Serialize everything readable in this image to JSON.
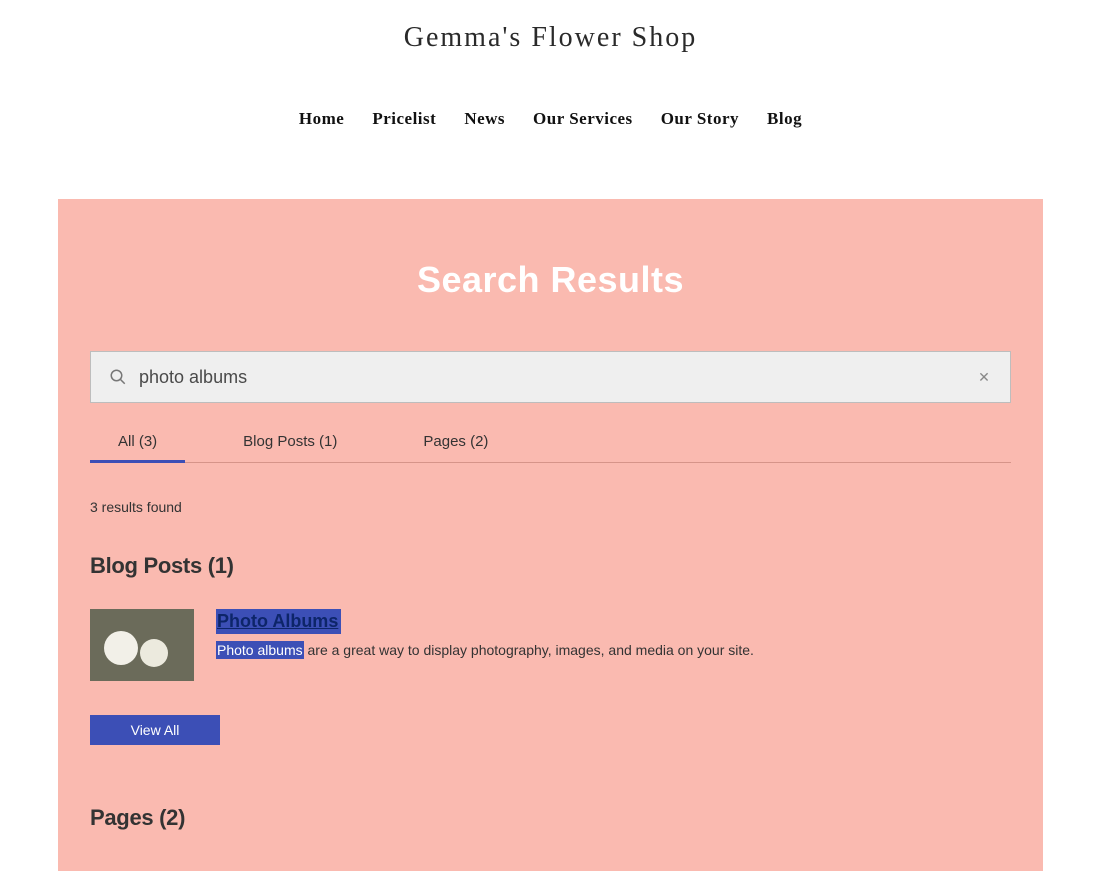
{
  "header": {
    "site_title": "Gemma's Flower Shop",
    "nav": [
      "Home",
      "Pricelist",
      "News",
      "Our Services",
      "Our Story",
      "Blog"
    ]
  },
  "search": {
    "heading": "Search Results",
    "query": "photo albums",
    "tabs": [
      {
        "label": "All (3)",
        "active": true
      },
      {
        "label": "Blog Posts (1)",
        "active": false
      },
      {
        "label": "Pages (2)",
        "active": false
      }
    ],
    "results_found": "3 results found"
  },
  "sections": {
    "blog_posts": {
      "title": "Blog Posts (1)",
      "items": [
        {
          "title": "Photo Albums",
          "highlight": "Photo albums",
          "desc_rest": " are a great way to display photography, images, and media on your site."
        }
      ],
      "view_all": "View All"
    },
    "pages": {
      "title": "Pages (2)"
    }
  }
}
